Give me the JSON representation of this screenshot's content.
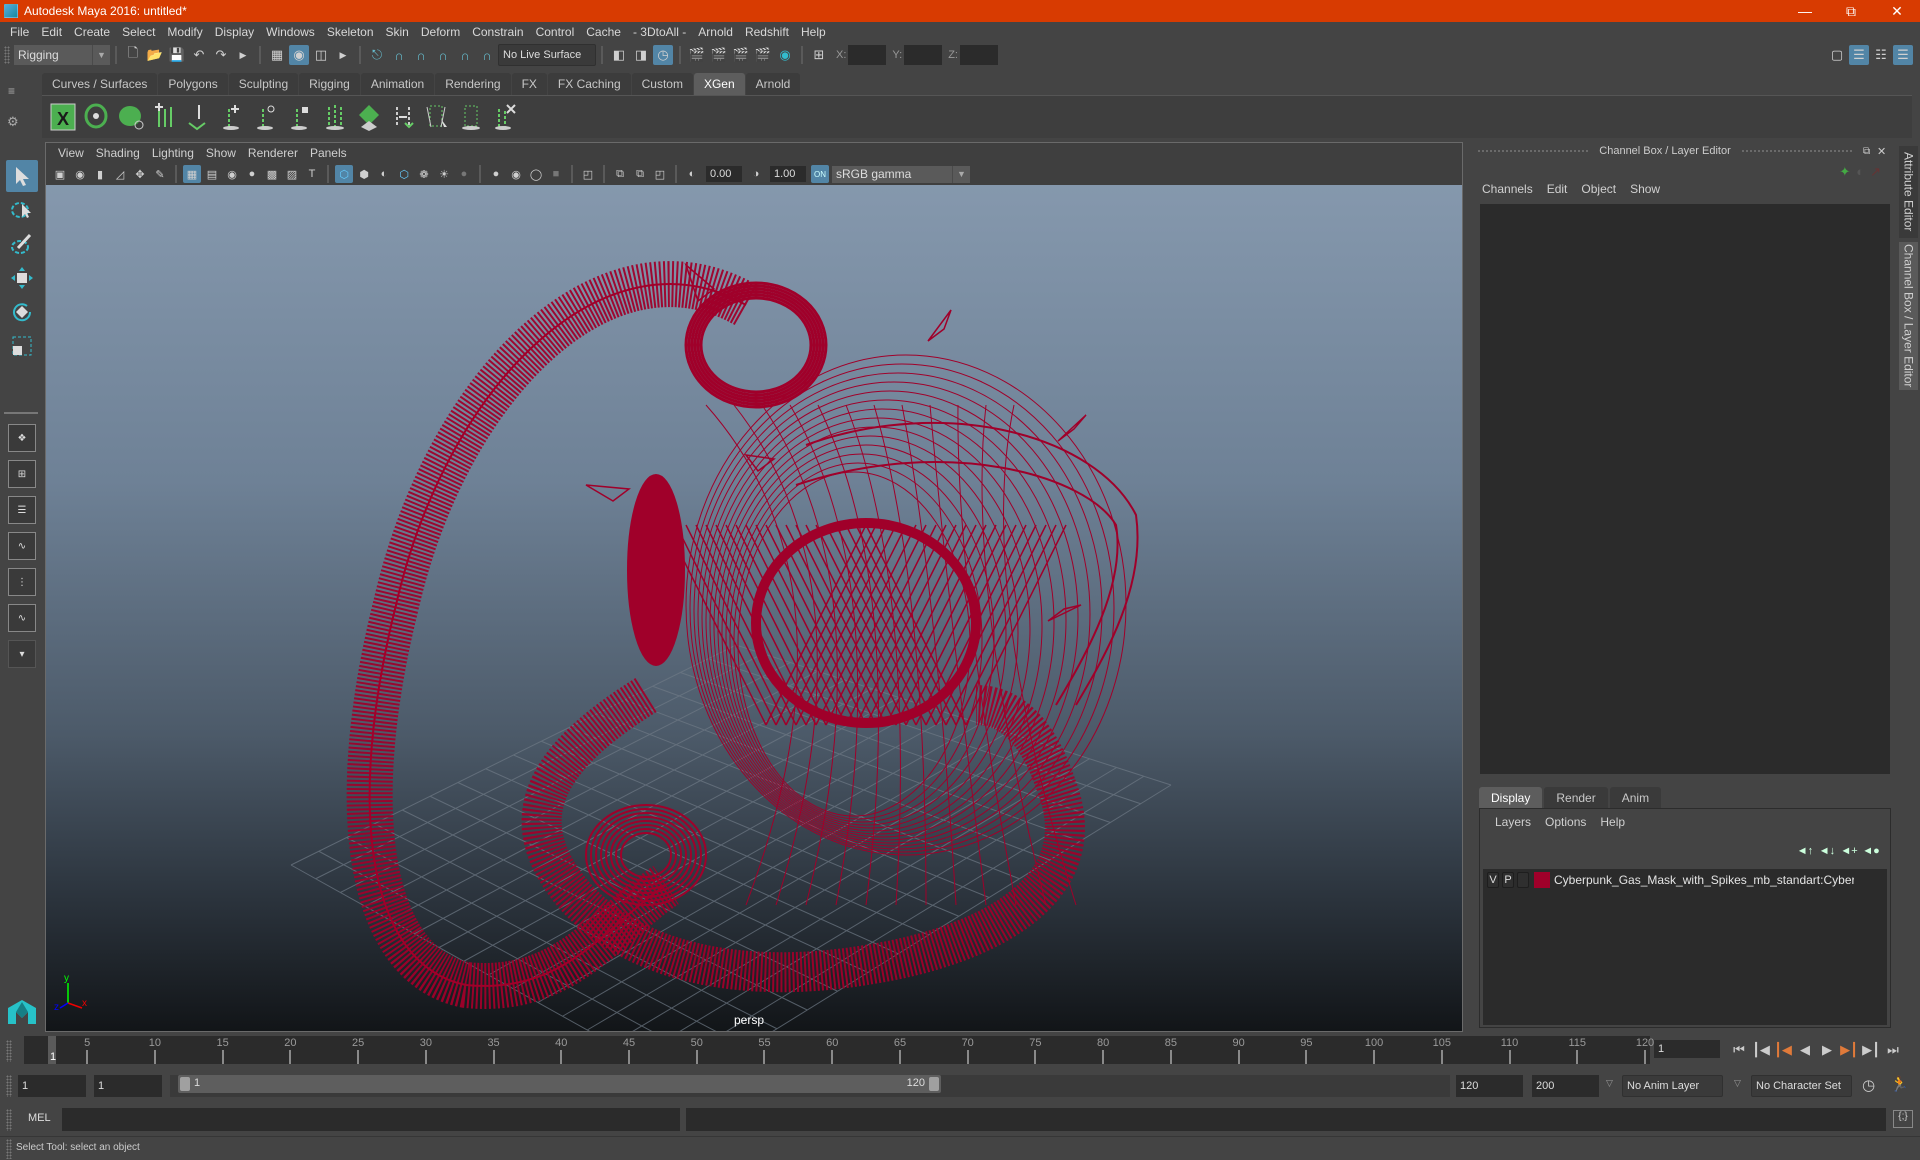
{
  "window": {
    "title": "Autodesk Maya 2016: untitled*",
    "controls": [
      "minimize",
      "restore",
      "close"
    ]
  },
  "menubar": [
    "File",
    "Edit",
    "Create",
    "Select",
    "Modify",
    "Display",
    "Windows",
    "Skeleton",
    "Skin",
    "Deform",
    "Constrain",
    "Control",
    "Cache",
    "- 3DtoAll -",
    "Arnold",
    "Redshift",
    "Help"
  ],
  "statusline": {
    "menuset": "Rigging",
    "live_surface": "No Live Surface",
    "xyz_labels": [
      "X:",
      "Y:",
      "Z:"
    ],
    "xyz_values": [
      "",
      "",
      ""
    ]
  },
  "shelf": {
    "tabs": [
      "Curves / Surfaces",
      "Polygons",
      "Sculpting",
      "Rigging",
      "Animation",
      "Rendering",
      "FX",
      "FX Caching",
      "Custom",
      "XGen",
      "Arnold"
    ],
    "active_tab": "XGen",
    "icons": [
      "xgen-editor-icon",
      "xgen-preview-icon",
      "xgen-clear-preview-icon",
      "add-guides-icon",
      "place-guides-icon",
      "add-guide-icon",
      "sculpt-guide-icon",
      "lock-guide-icon",
      "guides-to-curves-icon",
      "xgen-grid-icon",
      "guide-flip-icon",
      "select-guide-icon",
      "select-guide-tips-icon",
      "delete-guide-icon"
    ]
  },
  "viewport": {
    "menus": [
      "View",
      "Shading",
      "Lighting",
      "Show",
      "Renderer",
      "Panels"
    ],
    "exposure": "0.00",
    "gamma": "1.00",
    "color_space": "sRGB gamma",
    "camera_label": "persp",
    "axis_labels": {
      "x": "x",
      "y": "y",
      "z": "z"
    },
    "wireframe_color": "#a0002a"
  },
  "right_panel": {
    "title": "Channel Box / Layer Editor",
    "menus": [
      "Channels",
      "Edit",
      "Object",
      "Show"
    ],
    "layer_tabs": [
      "Display",
      "Render",
      "Anim"
    ],
    "active_layer_tab": "Display",
    "layer_menus": [
      "Layers",
      "Options",
      "Help"
    ],
    "layers": [
      {
        "visible": "V",
        "playback": "P",
        "color": "#a0002a",
        "name": "Cyberpunk_Gas_Mask_with_Spikes_mb_standart:Cyberpu"
      }
    ],
    "side_tabs": [
      "Attribute Editor",
      "Channel Box / Layer Editor"
    ]
  },
  "timeslider": {
    "current_frame": "1",
    "ticks": [
      5,
      10,
      15,
      20,
      25,
      30,
      35,
      40,
      45,
      50,
      55,
      60,
      65,
      70,
      75,
      80,
      85,
      90,
      95,
      100,
      105,
      110,
      115,
      120
    ],
    "start": 1,
    "end": 120,
    "current_frame_field": "1"
  },
  "rangeslider": {
    "start_time": "1",
    "playback_start": "1",
    "range_start_label": "1",
    "range_end_label": "120",
    "playback_end": "120",
    "end_time": "200",
    "anim_layer": "No Anim Layer",
    "character_set": "No Character Set"
  },
  "cmdline": {
    "label": "MEL",
    "value": ""
  },
  "helpline": {
    "text": "Select Tool: select an object"
  }
}
